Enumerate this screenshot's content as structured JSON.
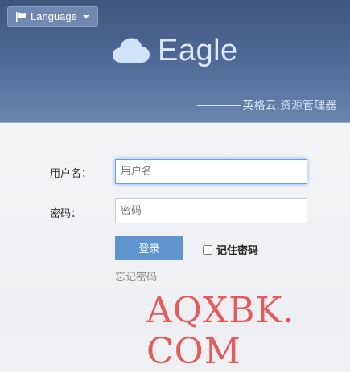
{
  "header": {
    "language_label": "Language",
    "brand_name": "Eagle",
    "tagline": "英格云.资源管理器"
  },
  "form": {
    "username_label": "用户名：",
    "username_placeholder": "用户名",
    "password_label": "密码：",
    "password_placeholder": "密码",
    "login_label": "登录",
    "remember_label": "记住密码",
    "forgot_label": "忘记密码"
  },
  "watermark": "AQXBK. COM",
  "colors": {
    "header_top": "#3f577d",
    "header_bottom": "#6a85ad",
    "brand_text": "#dbe9fb",
    "login_button": "#5f95cf",
    "watermark": "#e44b4b"
  },
  "icons": {
    "language": "flag-icon",
    "dropdown": "caret-down-icon",
    "brand": "cloud-icon"
  }
}
